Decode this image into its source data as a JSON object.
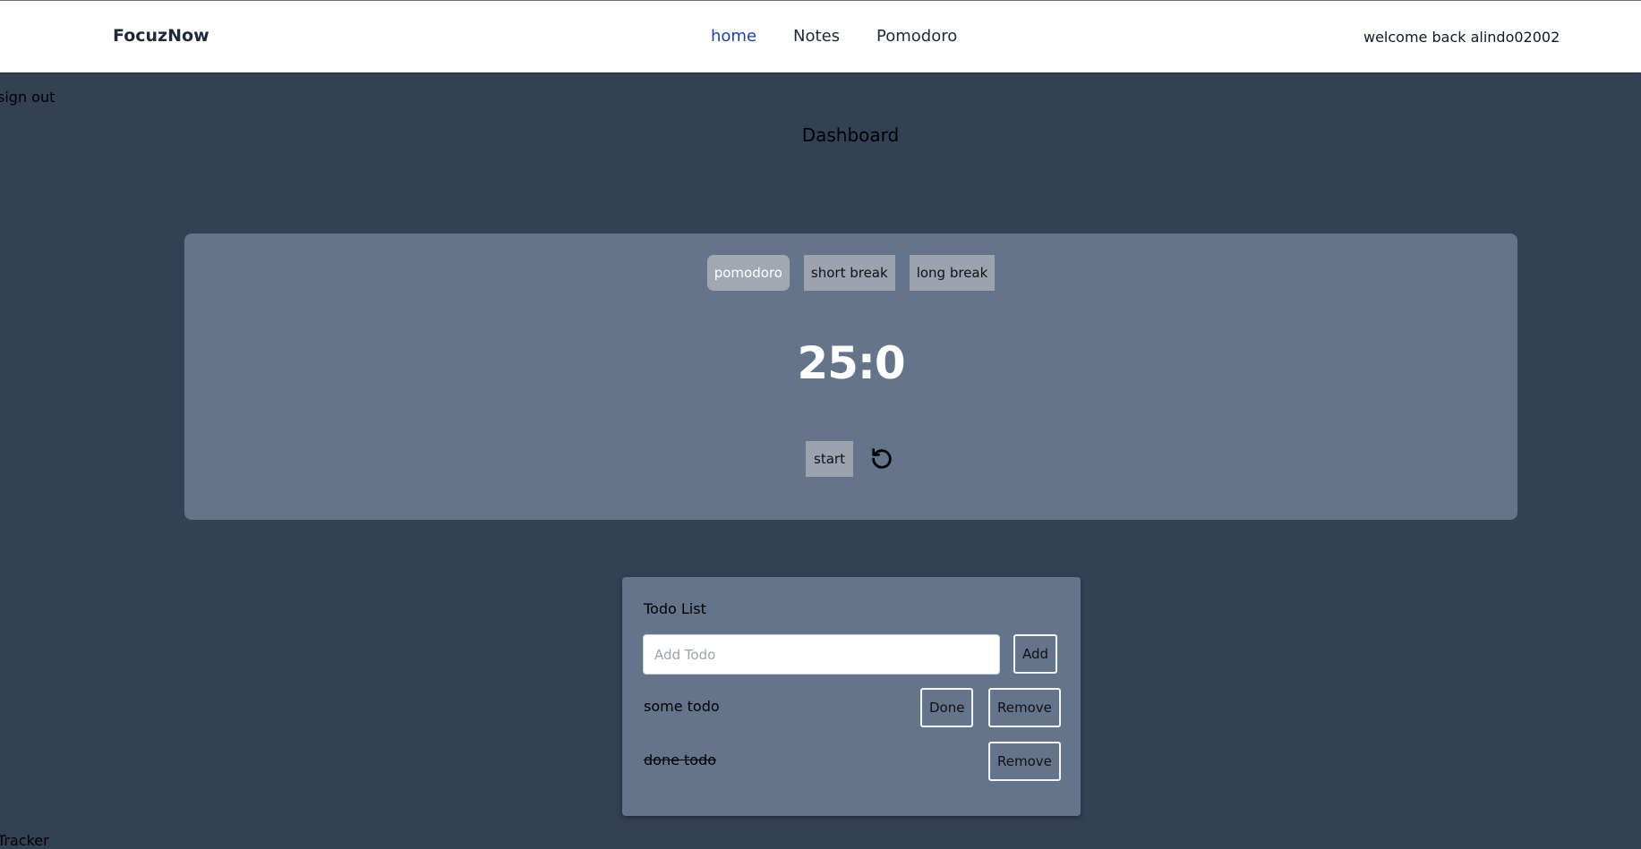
{
  "header": {
    "brand": "FocuzNow",
    "nav": [
      {
        "label": "home",
        "active": true
      },
      {
        "label": "Notes",
        "active": false
      },
      {
        "label": "Pomodoro",
        "active": false
      }
    ],
    "welcome": "welcome back alindo02002"
  },
  "signout_label": "sign out",
  "dashboard_title": "Dashboard",
  "timer": {
    "modes": [
      {
        "label": "pomodoro",
        "active": true
      },
      {
        "label": "short break",
        "active": false
      },
      {
        "label": "long break",
        "active": false
      }
    ],
    "time": "25:0",
    "start_label": "start",
    "reset_icon": "reset-icon"
  },
  "todo": {
    "title": "Todo List",
    "input_placeholder": "Add Todo",
    "input_value": "",
    "add_label": "Add",
    "items": [
      {
        "text": "some todo",
        "done": false,
        "done_label": "Done",
        "remove_label": "Remove"
      },
      {
        "text": "done todo",
        "done": true,
        "remove_label": "Remove"
      }
    ]
  },
  "footer_label": "Tracker",
  "colors": {
    "page_bg": "#334155",
    "card_bg": "#64748b",
    "nav_active": "#1e40af",
    "button_bg": "#9ca3af"
  }
}
